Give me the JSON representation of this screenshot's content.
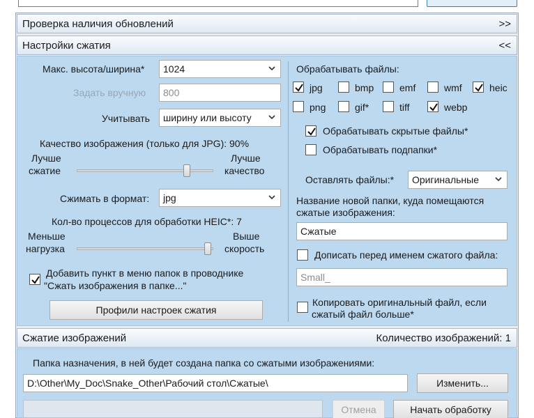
{
  "top": {
    "field_text": "",
    "button_label": ""
  },
  "updates_section": {
    "title": "Проверка наличия обновлений",
    "toggle": ">>"
  },
  "compression_settings": {
    "title": "Настройки сжатия",
    "toggle": "<<",
    "max_size_label": "Макс. высота/ширина*",
    "max_size_value": "1024",
    "manual_label": "Задать вручную",
    "manual_value": "800",
    "consider_label": "Учитывать",
    "consider_value": "ширину или высоту",
    "quality_label": "Качество изображения (только для JPG): 90%",
    "quality_percent": 90,
    "quality_left_1": "Лучше",
    "quality_left_2": "сжатие",
    "quality_right_1": "Лучше",
    "quality_right_2": "качество",
    "format_label": "Сжимать в формат:",
    "format_value": "jpg",
    "heic_label": "Кол-во процессов для обработки HEIC*: 7",
    "heic_left_1": "Меньше",
    "heic_left_2": "нагрузка",
    "heic_right_1": "Выше",
    "heic_right_2": "скорость",
    "context_menu_line1": "Добавить пункт в меню папок в проводнике",
    "context_menu_line2": "\"Сжать изображения в папке...\"",
    "context_menu_checked": true,
    "profiles_button": "Профили настроек сжатия",
    "process_files_label": "Обрабатывать файлы:",
    "file_types": [
      {
        "label": "jpg",
        "checked": true
      },
      {
        "label": "bmp",
        "checked": false
      },
      {
        "label": "emf",
        "checked": false
      },
      {
        "label": "wmf",
        "checked": false
      },
      {
        "label": "heic",
        "checked": true
      },
      {
        "label": "png",
        "checked": false
      },
      {
        "label": "gif*",
        "checked": false
      },
      {
        "label": "tiff",
        "checked": false
      },
      {
        "label": "webp",
        "checked": true
      }
    ],
    "hidden_files_label": "Обрабатывать скрытые файлы*",
    "hidden_files_checked": true,
    "subfolders_label": "Обрабатывать подпапки*",
    "subfolders_checked": false,
    "keep_files_label": "Оставлять файлы:*",
    "keep_files_value": "Оригинальные",
    "folder_name_label_1": "Название новой папки, куда помещаются",
    "folder_name_label_2": "сжатые изображения:",
    "folder_name_value": "Сжатые",
    "prefix_label": "Дописать перед именем сжатого файла:",
    "prefix_checked": false,
    "prefix_value": "Small_",
    "copy_original_line1": "Копировать оригинальный файл, если",
    "copy_original_line2": "сжатый файл больше*",
    "copy_original_checked": false
  },
  "compression": {
    "title": "Сжатие изображений",
    "count_label": "Количество изображений: 1",
    "destination_label": "Папка назначения, в ней будет создана папка со сжатыми изображениями:",
    "destination_path": "D:\\Other\\My_Doc\\Snake_Other\\Рабочий стол\\Сжатые\\",
    "change_button": "Изменить...",
    "cancel_button": "Отмена",
    "start_button": "Начать обработку",
    "progress": 0
  }
}
